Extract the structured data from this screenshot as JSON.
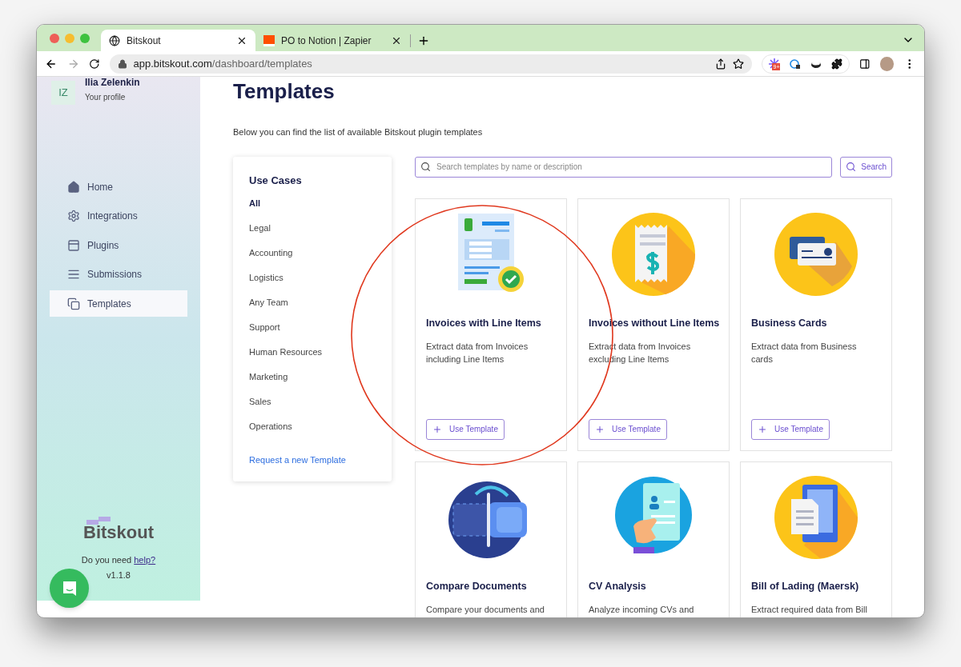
{
  "browser": {
    "tabs": [
      {
        "title": "Bitskout",
        "selected": true
      },
      {
        "title": "PO to Notion | Zapier",
        "selected": false
      }
    ],
    "url_host": "app.bitskout.com",
    "url_path": "/dashboard/templates",
    "extension_badge": "9+"
  },
  "profile": {
    "initials": "IZ",
    "name": "Ilia Zelenkin",
    "subtitle": "Your profile"
  },
  "nav": [
    {
      "kind": "home",
      "label": "Home",
      "selected": false
    },
    {
      "kind": "gear",
      "label": "Integrations",
      "selected": false
    },
    {
      "kind": "window",
      "label": "Plugins",
      "selected": false
    },
    {
      "kind": "lines",
      "label": "Submissions",
      "selected": false
    },
    {
      "kind": "copy",
      "label": "Templates",
      "selected": true
    }
  ],
  "brand": "Bitskout",
  "help_prefix": "Do you need ",
  "help_link": "help?",
  "version": "v1.1.8",
  "page": {
    "title": "Templates",
    "subtitle": "Below you can find the list of available Bitskout plugin templates"
  },
  "use_cases": {
    "title": "Use Cases",
    "items": [
      {
        "label": "All",
        "selected": true
      },
      {
        "label": "Legal",
        "selected": false
      },
      {
        "label": "Accounting",
        "selected": false
      },
      {
        "label": "Logistics",
        "selected": false
      },
      {
        "label": "Any Team",
        "selected": false
      },
      {
        "label": "Support",
        "selected": false
      },
      {
        "label": "Human Resources",
        "selected": false
      },
      {
        "label": "Marketing",
        "selected": false
      },
      {
        "label": "Sales",
        "selected": false
      },
      {
        "label": "Operations",
        "selected": false
      }
    ],
    "request_link": "Request a new Template"
  },
  "search": {
    "placeholder": "Search templates by name or description",
    "button": "Search"
  },
  "templates": [
    {
      "kind": "invoice",
      "title": "Invoices with Line Items",
      "description": "Extract data from Invoices including Line Items",
      "button": "Use Template"
    },
    {
      "kind": "receipt",
      "title": "Invoices without Line Items",
      "description": "Extract data from Invoices excluding Line Items",
      "button": "Use Template"
    },
    {
      "kind": "card",
      "title": "Business Cards",
      "description": "Extract data from Business cards",
      "button": "Use Template"
    },
    {
      "kind": "compare",
      "title": "Compare Documents",
      "description": "Compare your documents and"
    },
    {
      "kind": "cv",
      "title": "CV Analysis",
      "description": "Analyze incoming CVs and"
    },
    {
      "kind": "phone",
      "title": "Bill of Lading (Maersk)",
      "description": "Extract required data from Bill"
    }
  ]
}
